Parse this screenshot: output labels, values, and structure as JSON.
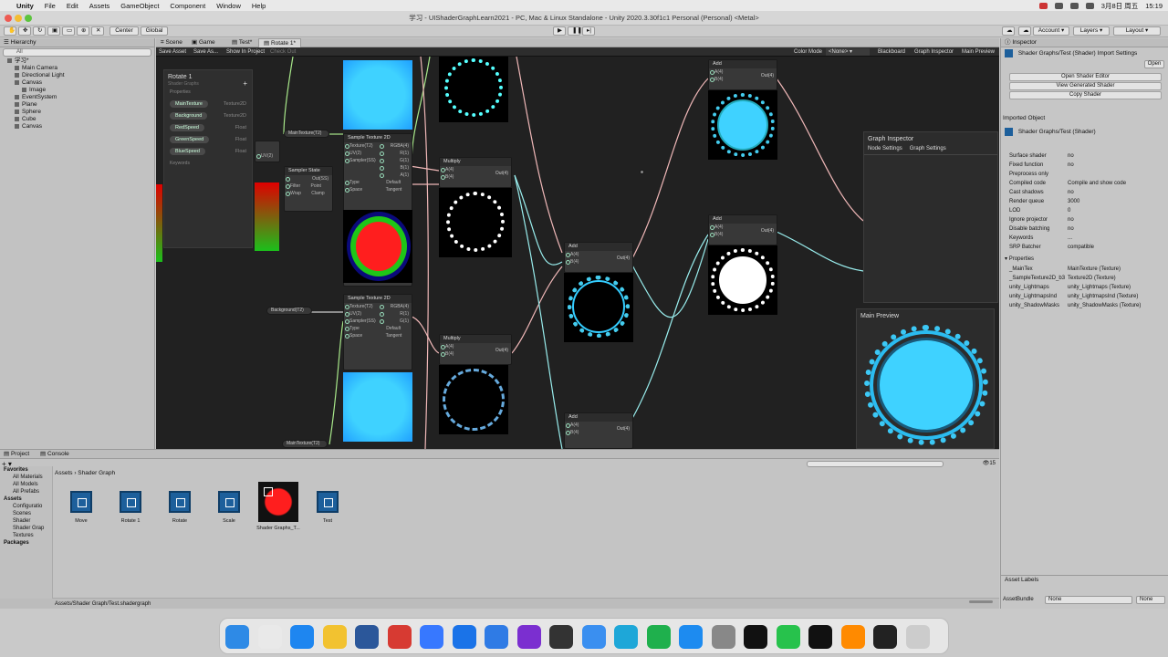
{
  "menubar": {
    "app_name": "Unity",
    "items": [
      "File",
      "Edit",
      "Assets",
      "GameObject",
      "Component",
      "Window",
      "Help"
    ],
    "date": "3月8日 周五",
    "time": "15:19"
  },
  "window": {
    "title": "学习 - UIShaderGraphLearn2021 - PC, Mac & Linux Standalone - Unity 2020.3.30f1c1 Personal (Personal) <Metal>"
  },
  "toolbar": {
    "center_label": "Center",
    "global_label": "Global",
    "account_label": "Account",
    "layers_label": "Layers",
    "layout_label": "Layout"
  },
  "hierarchy": {
    "tab": "Hierarchy",
    "search_placeholder": "All",
    "items": [
      {
        "label": "学习*",
        "depth": 0
      },
      {
        "label": "Main Camera",
        "depth": 1
      },
      {
        "label": "Directional Light",
        "depth": 1
      },
      {
        "label": "Canvas",
        "depth": 1
      },
      {
        "label": "Image",
        "depth": 2
      },
      {
        "label": "EventSystem",
        "depth": 1
      },
      {
        "label": "Plane",
        "depth": 1
      },
      {
        "label": "Sphere",
        "depth": 1
      },
      {
        "label": "Cube",
        "depth": 1
      },
      {
        "label": "Canvas",
        "depth": 1
      }
    ]
  },
  "scene_tabs": [
    "Scene",
    "Game",
    "Test*",
    "Rotate 1*"
  ],
  "graph_toolbar": {
    "save_asset": "Save Asset",
    "save_as": "Save As...",
    "show_in_project": "Show In Project",
    "check_out": "Check Out",
    "color_mode_label": "Color Mode",
    "color_mode_value": "<None>",
    "blackboard": "Blackboard",
    "graph_inspector": "Graph Inspector",
    "main_preview": "Main Preview"
  },
  "blackboard": {
    "title": "Rotate 1",
    "subtitle": "Shader Graphs",
    "section": "Properties",
    "properties": [
      {
        "name": "MainTexture",
        "type": "Texture2D"
      },
      {
        "name": "Background",
        "type": "Texture2D"
      },
      {
        "name": "RedSpeed",
        "type": "Float"
      },
      {
        "name": "GreenSpeed",
        "type": "Float"
      },
      {
        "name": "BlueSpeed",
        "type": "Float"
      }
    ],
    "keywords": "Keywords"
  },
  "nodes": {
    "sample1_title": "Sample Texture 2D",
    "sample2_title": "Sample Texture 2D",
    "multiply1_title": "Multiply",
    "multiply2_title": "Multiply",
    "add1_title": "Add",
    "add2_title": "Add",
    "add3_title": "Add",
    "add4_title": "Add",
    "sampler_title": "Sampler State",
    "ports_sample": [
      "Texture(T2)",
      "UV(2)",
      "Sampler(SS)"
    ],
    "outputs_sample": [
      "RGBA(4)",
      "R(1)",
      "G(1)",
      "B(1)",
      "A(1)"
    ],
    "type_label": "Type",
    "type_value": "Default",
    "space_label": "Space",
    "space_value": "Tangent",
    "filter_label": "Filter",
    "filter_value": "Point",
    "wrap_label": "Wrap",
    "wrap_value": "Clamp",
    "ports_ab": [
      "A(4)",
      "B(4)"
    ],
    "out_label": "Out(4)",
    "prop_main": "MainTexture(T2)",
    "prop_bg": "Background(T2)",
    "prop_other": "MainTexture(T2)"
  },
  "graph_inspector_panel": {
    "title": "Graph Inspector",
    "tab_node": "Node Settings",
    "tab_graph": "Graph Settings"
  },
  "main_preview_panel": {
    "title": "Main Preview"
  },
  "inspector": {
    "tab": "Inspector",
    "header": "Shader Graphs/Test (Shader) Import Settings",
    "open_button": "Open",
    "btn_open_editor": "Open Shader Editor",
    "btn_view_generated": "View Generated Shader",
    "btn_copy": "Copy Shader",
    "imported_object": "Imported Object",
    "shader_name": "Shader Graphs/Test (Shader)",
    "rows": [
      {
        "k": "Surface shader",
        "v": "no"
      },
      {
        "k": "Fixed function",
        "v": "no"
      },
      {
        "k": "Preprocess only",
        "v": ""
      },
      {
        "k": "Compiled code",
        "v": "Compile and show code"
      },
      {
        "k": "Cast shadows",
        "v": "no"
      },
      {
        "k": "Render queue",
        "v": "3000"
      },
      {
        "k": "LOD",
        "v": "0"
      },
      {
        "k": "Ignore projector",
        "v": "no"
      },
      {
        "k": "Disable batching",
        "v": "no"
      },
      {
        "k": "Keywords",
        "v": "..."
      },
      {
        "k": "SRP Batcher",
        "v": "compatible"
      }
    ],
    "properties_header": "Properties",
    "properties": [
      {
        "k": "_MainTex",
        "v": "MainTexture (Texture)"
      },
      {
        "k": "_SampleTexture2D_b3",
        "v": "Texture2D (Texture)"
      },
      {
        "k": "unity_Lightmaps",
        "v": "unity_Lightmaps (Texture)"
      },
      {
        "k": "unity_LightmapsInd",
        "v": "unity_LightmapsInd (Texture)"
      },
      {
        "k": "unity_ShadowMasks",
        "v": "unity_ShadowMasks (Texture)"
      }
    ],
    "asset_labels": "Asset Labels",
    "asset_bundle_label": "AssetBundle",
    "asset_bundle_value": "None",
    "asset_variant_value": "None"
  },
  "project": {
    "tab_project": "Project",
    "tab_console": "Console",
    "breadcrumb_root": "Assets",
    "breadcrumb_leaf": "Shader Graph",
    "count": "15",
    "favorites": "Favorites",
    "fav_items": [
      "All Materials",
      "All Models",
      "All Prefabs"
    ],
    "assets": "Assets",
    "asset_folders": [
      "Configuratio",
      "Scenes",
      "Shader",
      "Shader Grap",
      "Textures"
    ],
    "packages": "Packages",
    "files": [
      "Move",
      "Rotate 1",
      "Rotate",
      "Scale",
      "Shader Graphs_T...",
      "Test"
    ],
    "path": "Assets/Shader Graph/Test.shadergraph"
  },
  "colors": {
    "accent_blue": "#3fd2ff",
    "red": "#ff1e1e",
    "green": "#2fd01f",
    "white": "#ffffff"
  }
}
